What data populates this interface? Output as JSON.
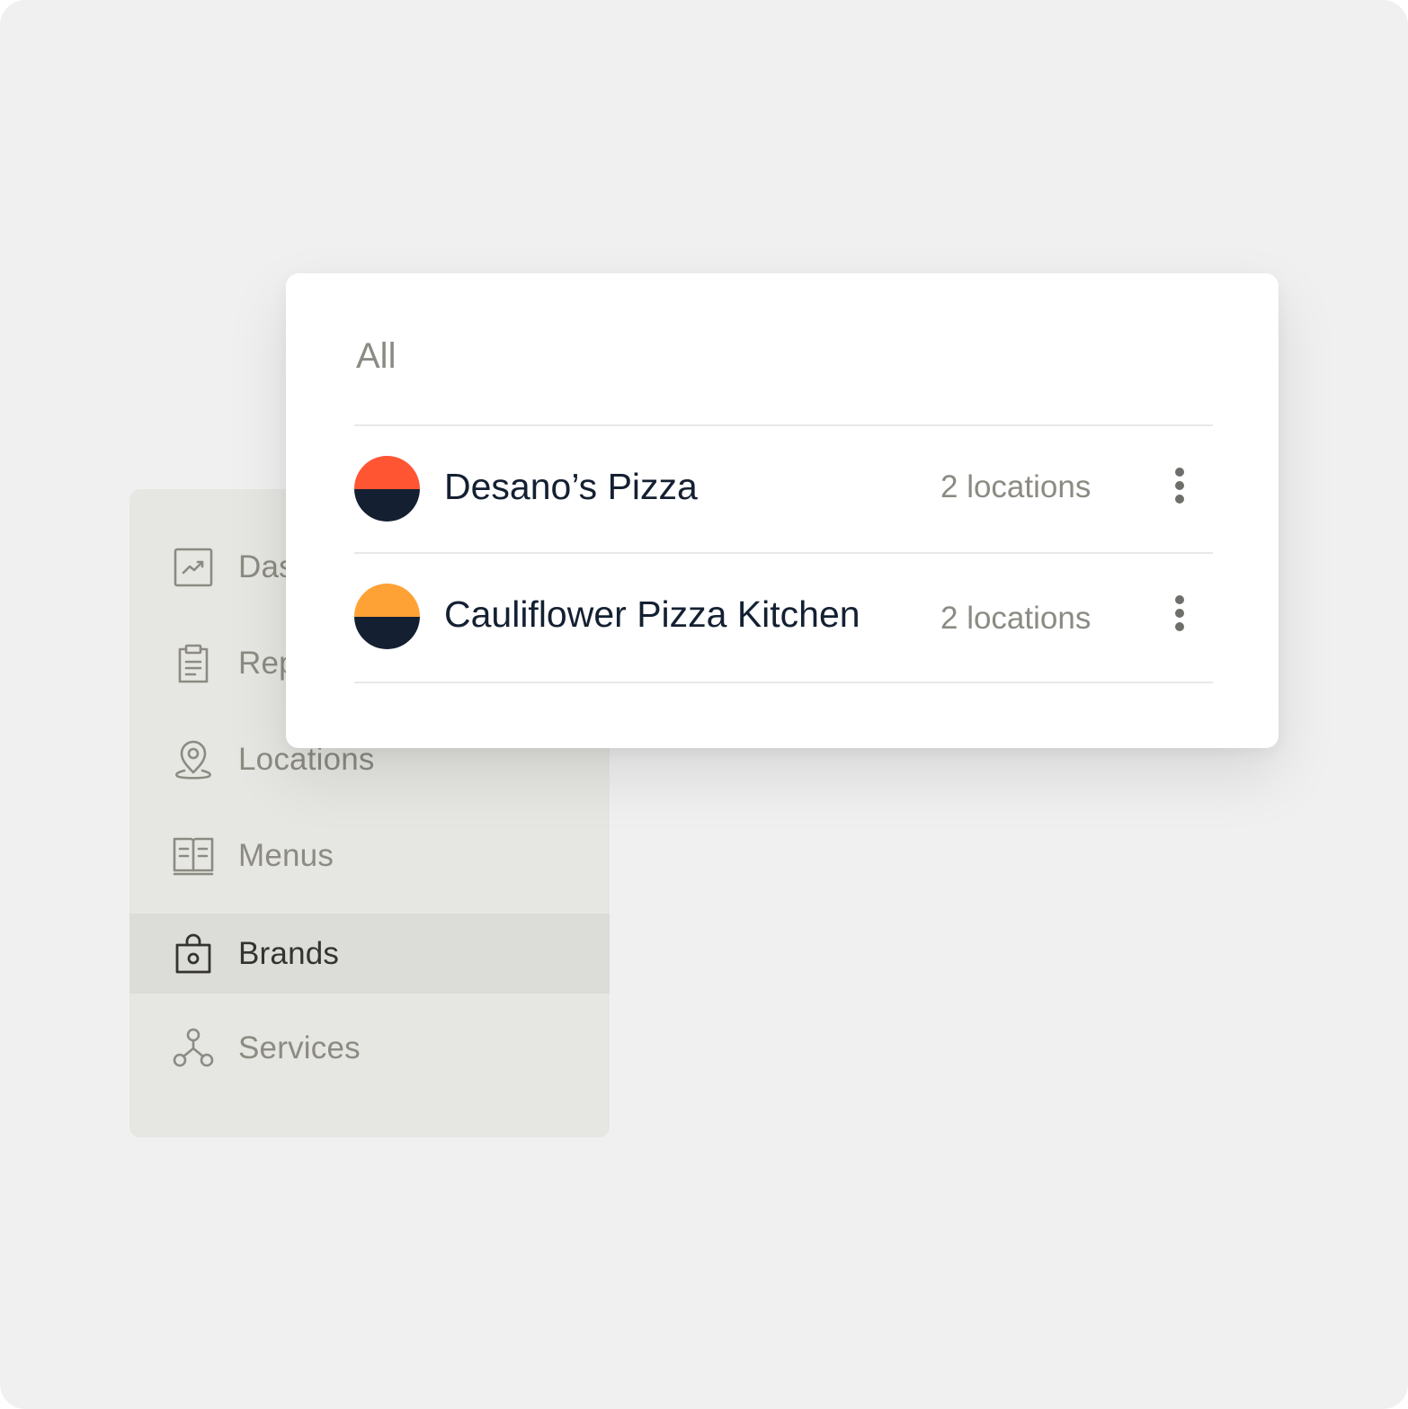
{
  "sidebar": {
    "items": [
      {
        "label": "Dashboard",
        "icon": "chart-trend-icon",
        "active": false
      },
      {
        "label": "Reports",
        "icon": "clipboard-icon",
        "active": false
      },
      {
        "label": "Locations",
        "icon": "map-pin-icon",
        "active": false
      },
      {
        "label": "Menus",
        "icon": "open-book-icon",
        "active": false
      },
      {
        "label": "Brands",
        "icon": "shopping-bag-icon",
        "active": true
      },
      {
        "label": "Services",
        "icon": "connected-nodes-icon",
        "active": false
      }
    ]
  },
  "brands_panel": {
    "heading": "All",
    "brands": [
      {
        "name": "Desano’s Pizza",
        "locations": "2 locations",
        "logo_top_color": "#ff5533",
        "logo_bottom_color": "#142032"
      },
      {
        "name": "Cauliflower Pizza Kitchen",
        "locations": "2 locations",
        "logo_top_color": "#ffa236",
        "logo_bottom_color": "#142032"
      }
    ]
  },
  "colors": {
    "background": "#f0f0f0",
    "sidebar": "#e6e6e2",
    "sidebar_active": "#dcdcd8",
    "muted_text": "#8c8b83",
    "dark_text": "#142032"
  }
}
